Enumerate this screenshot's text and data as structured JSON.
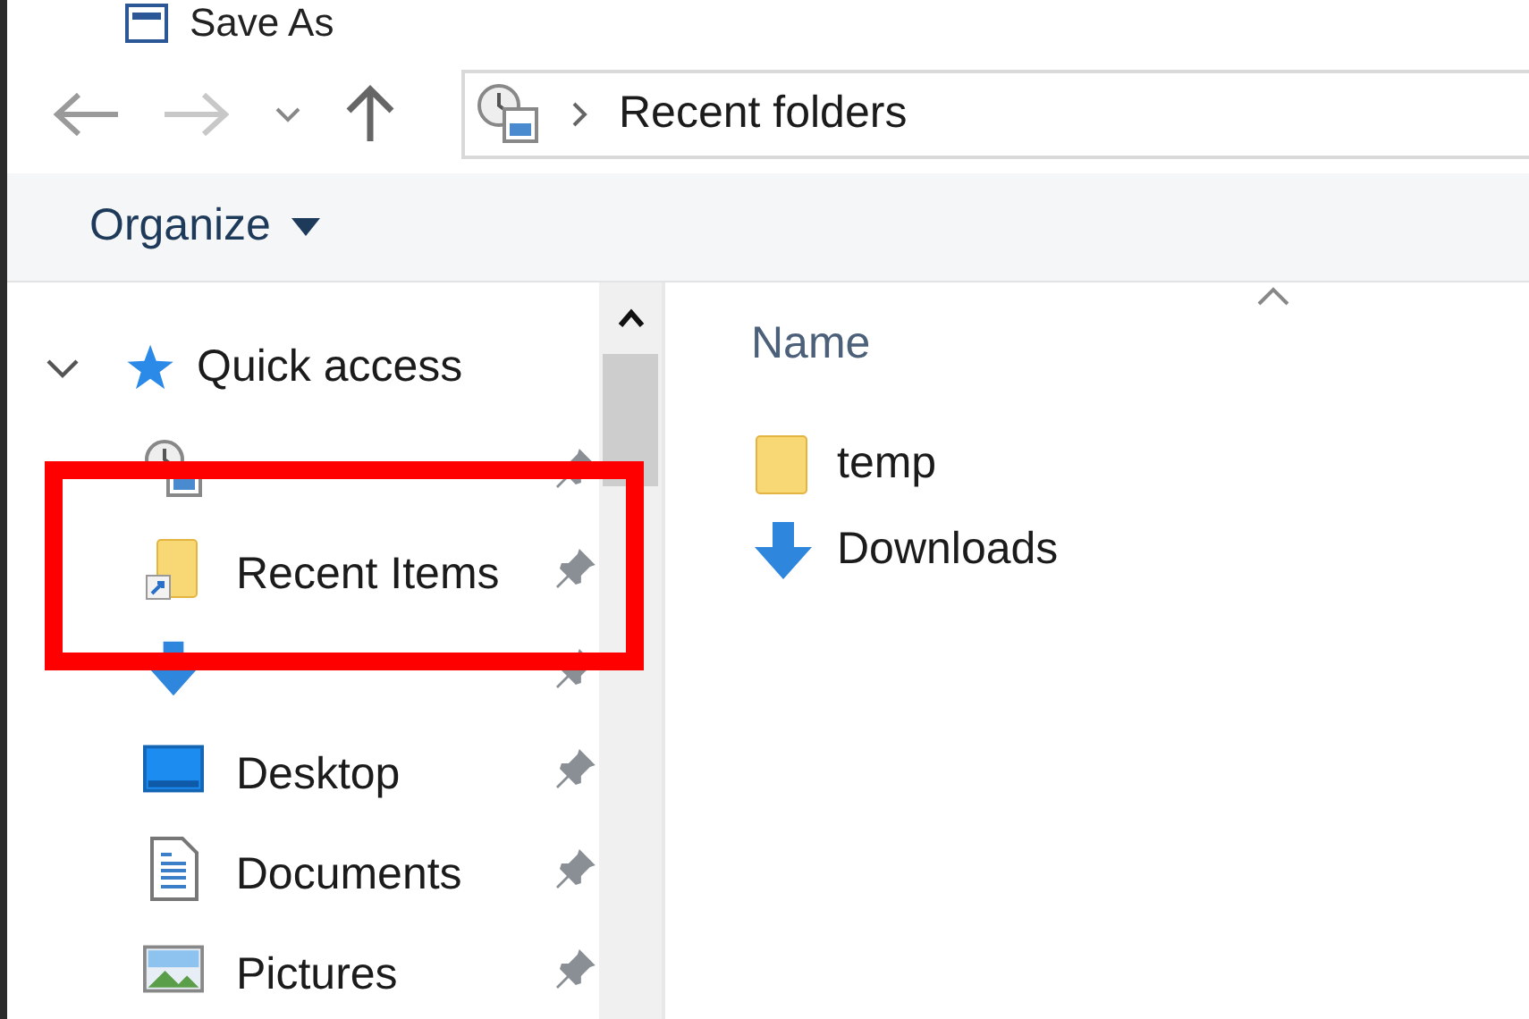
{
  "window": {
    "title": "Save As"
  },
  "navigation": {
    "address": {
      "path": "Recent folders"
    }
  },
  "toolbar": {
    "organize": "Organize"
  },
  "sidebar": {
    "items": [
      {
        "label": "Quick access",
        "kind": "star",
        "expanded": true,
        "children": [
          {
            "kind": "recent",
            "pinned": true,
            "highlighted": false
          },
          {
            "label": "Recent Items",
            "kind": "shortcut-folder",
            "pinned": true,
            "highlighted": true
          },
          {
            "kind": "download",
            "pinned": true,
            "highlighted": false
          },
          {
            "label": "Desktop",
            "kind": "desktop",
            "pinned": true,
            "highlighted": false
          },
          {
            "label": "Documents",
            "kind": "document",
            "pinned": true,
            "highlighted": false
          },
          {
            "label": "Pictures",
            "kind": "pictures",
            "pinned": true,
            "highlighted": false
          }
        ]
      }
    ]
  },
  "file_list": {
    "columns": [
      {
        "label": "Name",
        "sorted": true
      }
    ],
    "rows": [
      {
        "name": "temp",
        "kind": "folder"
      },
      {
        "name": "Downloads",
        "kind": "download"
      }
    ]
  }
}
